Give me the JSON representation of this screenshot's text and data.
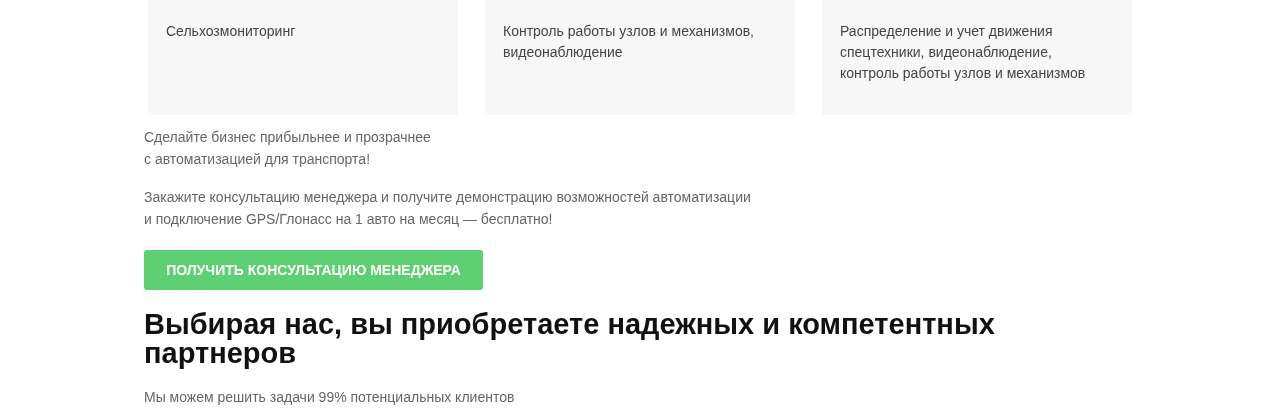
{
  "cards": [
    {
      "description": "Сельхозмониторинг"
    },
    {
      "description": "Контроль работы узлов и механизмов, видеонаблюдение"
    },
    {
      "description": "Распределение и учет движения спецтехники, видеонаблюдение, контроль работы узлов и механизмов"
    }
  ],
  "promo": {
    "lead": "Сделайте бизнес прибыльнее и прозрачнее\nс автоматизацией для транспорта!",
    "offer": "Закажите консультацию менеджера и получите демонстрацию возможностей автоматизации\nи подключение GPS/Глонасс на 1 авто на месяц — бесплатно!",
    "button": "ПОЛУЧИТЬ КОНСУЛЬТАЦИЮ МЕНЕДЖЕРА"
  },
  "section": {
    "title": "Выбирая нас, вы приобретаете надежных и компетентных партнеров",
    "subtitle": "Мы можем решить задачи 99% потенциальных клиентов"
  }
}
